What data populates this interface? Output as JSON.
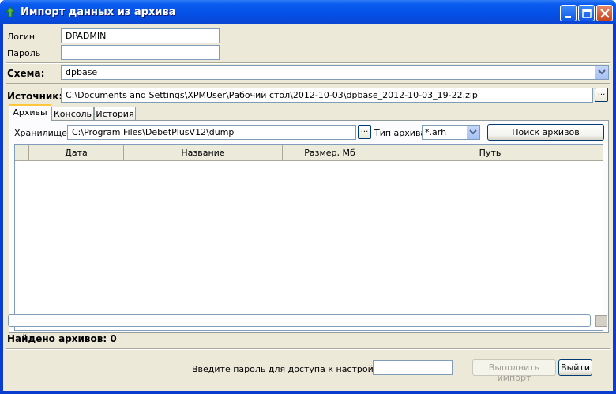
{
  "window": {
    "title": "Импорт данных из архива"
  },
  "login": {
    "label": "Логин",
    "value": "DPADMIN"
  },
  "password": {
    "label": "Пароль",
    "value": ""
  },
  "schema": {
    "label": "Схема:",
    "value": "dpbase"
  },
  "source": {
    "label": "Источник:",
    "value": "C:\\Documents and Settings\\XPMUser\\Рабочий стол\\2012-10-03\\dpbase_2012-10-03_19-22.zip",
    "browse_label": "..."
  },
  "tabs": [
    {
      "label": "Архивы",
      "active": true
    },
    {
      "label": "Консоль",
      "active": false
    },
    {
      "label": "История",
      "active": false
    }
  ],
  "storage": {
    "label": "Хранилище:",
    "value": "C:\\Program Files\\DebetPlusV12\\dump",
    "browse_label": "..."
  },
  "archive_type": {
    "label": "Тип архива",
    "value": "*.arh"
  },
  "search_button": "Поиск архивов",
  "table": {
    "columns": [
      "Дата",
      "Название",
      "Размер, Мб",
      "Путь"
    ],
    "rows": []
  },
  "status": {
    "found_text": "Найдено архивов: 0"
  },
  "settings_password": {
    "label": "Введите пароль для доступа к настройкам:",
    "value": ""
  },
  "buttons": {
    "import": "Выполнить импорт",
    "exit": "Выйти"
  },
  "colors": {
    "titlebar": "#0a5cf0",
    "window_bg": "#ece9d8",
    "tab_highlight": "#ffc83c"
  }
}
